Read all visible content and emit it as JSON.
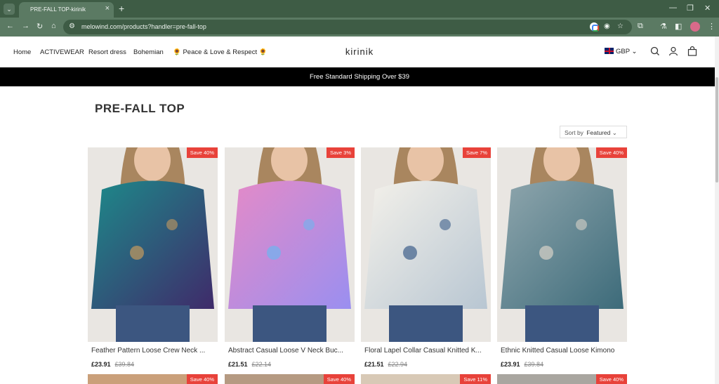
{
  "browser": {
    "tab_title": "PRE-FALL TOP-kirinik",
    "url": "melowind.com/products?handler=pre-fall-top",
    "tab_menu_icon": "chevron-down-icon",
    "new_tab_icon": "plus-icon",
    "close_tab_icon": "close-icon"
  },
  "nav": {
    "items": [
      "Home",
      "ACTIVEWEAR",
      "Resort dress",
      "Bohemian",
      "🌻 Peace & Love & Respect 🌻"
    ]
  },
  "header": {
    "logo": "kirinik",
    "currency": "GBP",
    "icons": [
      "search-icon",
      "user-icon",
      "cart-icon"
    ]
  },
  "announcement": "Free Standard Shipping Over $39",
  "collection": {
    "title": "PRE-FALL TOP",
    "sort_label": "Sort by",
    "sort_value": "Featured"
  },
  "products": [
    {
      "name": "Feather Pattern Loose Crew Neck ...",
      "price": "£23.91",
      "old_price": "£39.84",
      "badge": "Save 40%",
      "colors": [
        "#1d8a8a",
        "#3f2a6a",
        "#c49a5e"
      ]
    },
    {
      "name": "Abstract Casual Loose V Neck Buc...",
      "price": "£21.51",
      "old_price": "£22.14",
      "badge": "Save 3%",
      "colors": [
        "#e58ac7",
        "#9a8ff0",
        "#6fb4ef"
      ]
    },
    {
      "name": "Floral Lapel Collar Casual Knitted K...",
      "price": "£21.51",
      "old_price": "£22.94",
      "badge": "Save 7%",
      "colors": [
        "#f4f1ea",
        "#b8c6d2",
        "#3e5f8a"
      ]
    },
    {
      "name": "Ethnic Knitted Casual Loose Kimono",
      "price": "£23.91",
      "old_price": "£39.84",
      "badge": "Save 40%",
      "colors": [
        "#8fa6ad",
        "#3d6b7a",
        "#d7d2c8"
      ]
    }
  ],
  "next_row_badges": [
    "Save 40%",
    "Save 40%",
    "Save 11%",
    "Save 40%"
  ],
  "colors": {
    "chrome_dark": "#3e5c45",
    "chrome": "#5b7a63",
    "badge": "#e8423a",
    "announce_bg": "#000000"
  }
}
